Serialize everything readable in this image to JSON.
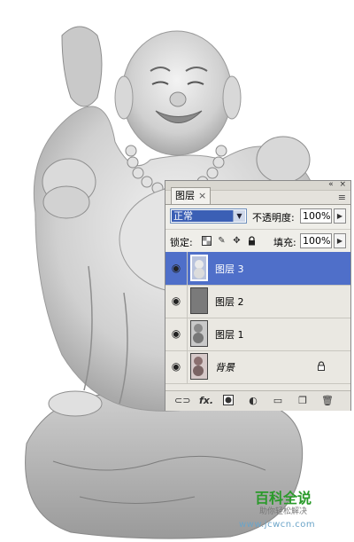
{
  "colors": {
    "selection": "#4f6fc9",
    "panel_bg": "#e4e2dc",
    "blend_highlight": "#3b5fb5",
    "watermark_green": "#2a9a2a",
    "watermark_url": "#6ba4c8"
  },
  "panel": {
    "tab_label": "图层",
    "close_icon": "×",
    "menu_icon": "≡",
    "window_controls": "« ×",
    "blend_mode": "正常",
    "opacity_label": "不透明度:",
    "opacity_value": "100%",
    "lock_label": "锁定:",
    "fill_label": "填充:",
    "fill_value": "100%",
    "icons": {
      "lock_transparent": "checker-icon",
      "lock_image": "brush-icon",
      "lock_position": "move-icon",
      "lock_all": "lock-icon"
    },
    "layers": [
      {
        "name": "图层 3",
        "selected": true
      },
      {
        "name": "图层 2",
        "selected": false
      },
      {
        "name": "图层 1",
        "selected": false
      },
      {
        "name": "背景",
        "selected": false,
        "locked": true
      }
    ],
    "bottom_icons": [
      "link-icon",
      "fx-icon",
      "mask-icon",
      "adjustment-icon",
      "group-icon",
      "new-layer-icon",
      "trash-icon"
    ],
    "fx_label": "fx."
  },
  "watermark": {
    "title": "百科全说",
    "subtitle": "助你轻松解决",
    "url": "www.jcwcn.com"
  }
}
